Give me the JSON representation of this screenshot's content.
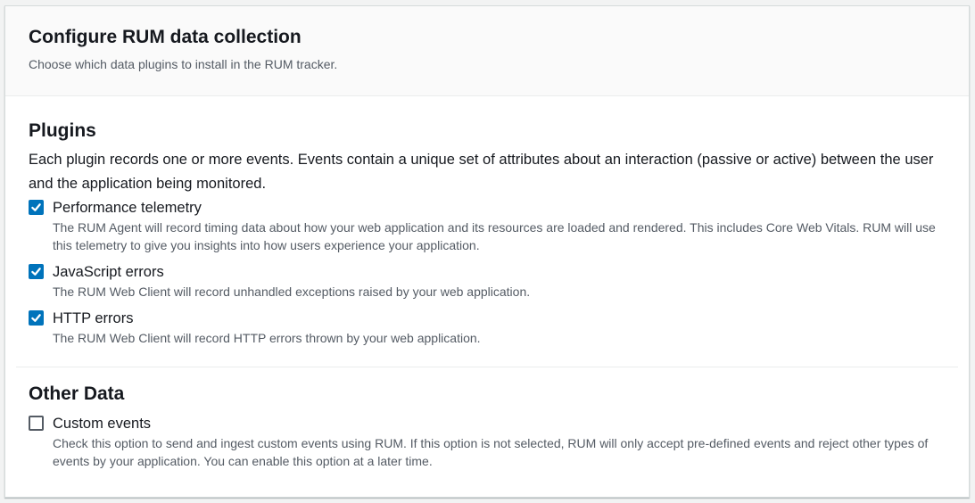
{
  "header": {
    "title": "Configure RUM data collection",
    "description": "Choose which data plugins to install in the RUM tracker."
  },
  "plugins": {
    "title": "Plugins",
    "description": "Each plugin records one or more events. Events contain a unique set of attributes about an interaction (passive or active) between the user and the application being monitored.",
    "items": [
      {
        "label": "Performance telemetry",
        "checked": true,
        "description": "The RUM Agent will record timing data about how your web application and its resources are loaded and rendered. This includes Core Web Vitals. RUM will use this telemetry to give you insights into how users experience your application."
      },
      {
        "label": "JavaScript errors",
        "checked": true,
        "description": "The RUM Web Client will record unhandled exceptions raised by your web application."
      },
      {
        "label": "HTTP errors",
        "checked": true,
        "description": "The RUM Web Client will record HTTP errors thrown by your web application."
      }
    ]
  },
  "other_data": {
    "title": "Other Data",
    "items": [
      {
        "label": "Custom events",
        "checked": false,
        "description": "Check this option to send and ingest custom events using RUM. If this option is not selected, RUM will only accept pre-defined events and reject other types of events by your application. You can enable this option at a later time."
      }
    ]
  },
  "colors": {
    "accent": "#0073bb",
    "text": "#16191f",
    "secondary_text": "#545b64"
  }
}
